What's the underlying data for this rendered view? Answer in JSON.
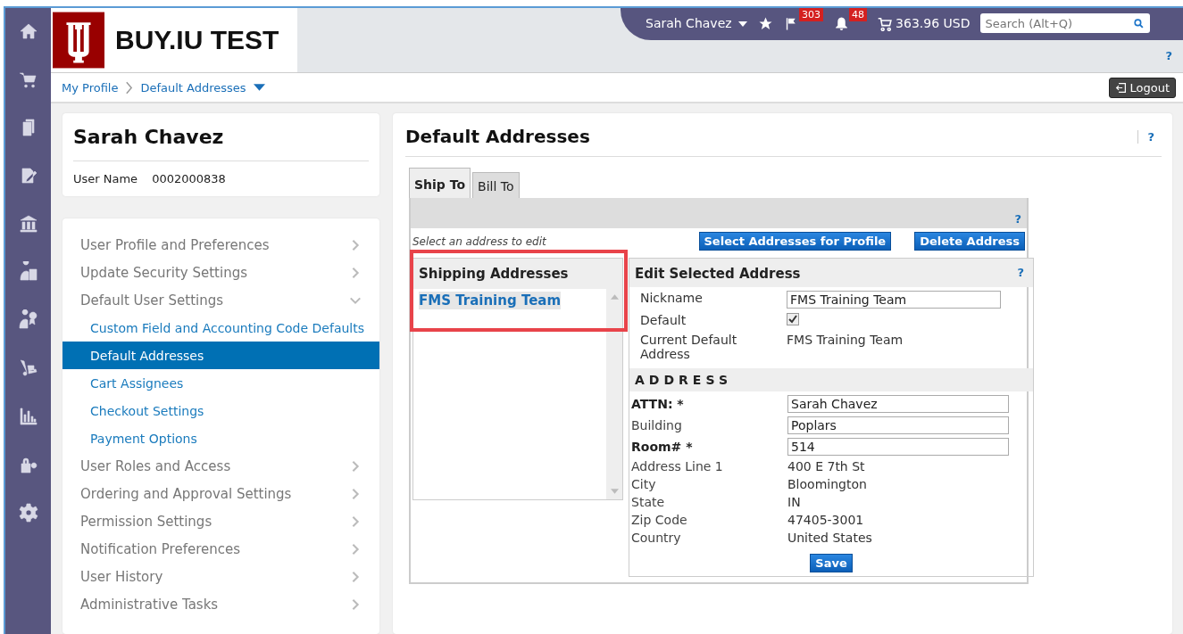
{
  "header": {
    "logo_text": "BUY.IU TEST",
    "user": "Sarah Chavez",
    "flag_count": "303",
    "bell_count": "48",
    "cart_total": "363.96 USD",
    "search": {
      "placeholder": "Search (Alt+Q)"
    },
    "help": "?"
  },
  "breadcrumb": [
    {
      "label": "My Profile"
    },
    {
      "label": "Default Addresses"
    }
  ],
  "logout": "Logout",
  "profile": {
    "name": "Sarah Chavez",
    "user_name_label": "User Name",
    "user_name": "0002000838"
  },
  "nav": [
    {
      "label": "User Profile and Preferences",
      "expanded": false
    },
    {
      "label": "Update Security Settings",
      "expanded": false
    },
    {
      "label": "Default User Settings",
      "expanded": true,
      "children": [
        {
          "label": "Custom Field and Accounting Code Defaults",
          "selected": false
        },
        {
          "label": "Default Addresses",
          "selected": true
        },
        {
          "label": "Cart Assignees",
          "selected": false
        },
        {
          "label": "Checkout Settings",
          "selected": false
        },
        {
          "label": "Payment Options",
          "selected": false
        }
      ]
    },
    {
      "label": "User Roles and Access",
      "expanded": false
    },
    {
      "label": "Ordering and Approval Settings",
      "expanded": false
    },
    {
      "label": "Permission Settings",
      "expanded": false
    },
    {
      "label": "Notification Preferences",
      "expanded": false
    },
    {
      "label": "User History",
      "expanded": false
    },
    {
      "label": "Administrative Tasks",
      "expanded": false
    }
  ],
  "main": {
    "title": "Default Addresses",
    "help": "?",
    "tabs": [
      {
        "label": "Ship To",
        "selected": true
      },
      {
        "label": "Bill To",
        "selected": false
      }
    ],
    "tab_help": "?",
    "hint": "Select an address to edit",
    "buttons": [
      "Select Addresses for Profile",
      "Delete Address"
    ],
    "shipping": {
      "title": "Shipping Addresses",
      "highlighted": true,
      "items": [
        {
          "label": "FMS Training Team",
          "selected": true
        }
      ]
    },
    "edit": {
      "title": "Edit Selected Address",
      "help": "?",
      "nickname_label": "Nickname",
      "nickname": "FMS Training Team",
      "default_label": "Default",
      "default_checked": true,
      "current_label": "Current Default Address",
      "current": "FMS Training Team",
      "address_heading": "ADDRESS",
      "fields": [
        {
          "label": "ATTN: *",
          "required": true,
          "kind": "input",
          "value": "Sarah Chavez"
        },
        {
          "label": "Building",
          "required": false,
          "kind": "input",
          "value": "Poplars"
        },
        {
          "label": "Room# *",
          "required": true,
          "kind": "input",
          "value": "514"
        },
        {
          "label": "Address Line 1",
          "required": false,
          "kind": "text",
          "value": "400 E 7th St"
        },
        {
          "label": "City",
          "required": false,
          "kind": "text",
          "value": "Bloomington"
        },
        {
          "label": "State",
          "required": false,
          "kind": "text",
          "value": "IN"
        },
        {
          "label": "Zip Code",
          "required": false,
          "kind": "text",
          "value": "47405-3001"
        },
        {
          "label": "Country",
          "required": false,
          "kind": "text",
          "value": "United States"
        }
      ],
      "save": "Save"
    }
  }
}
